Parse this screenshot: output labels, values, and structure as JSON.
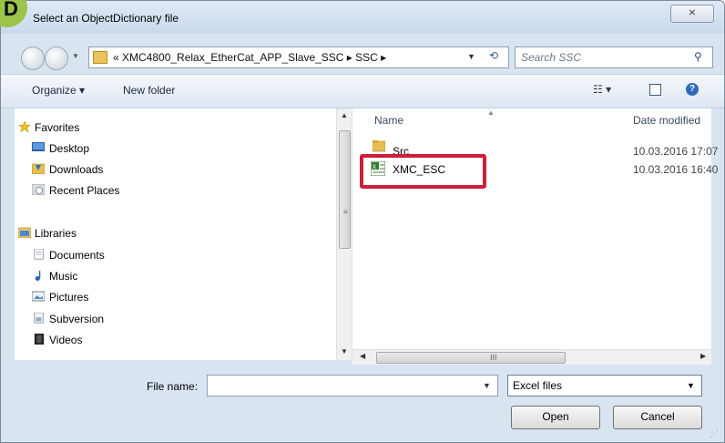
{
  "window": {
    "title": "Select an ObjectDictionary file",
    "close_glyph": "⨯"
  },
  "badge": {
    "letter": "D",
    "color": "#9cc34a"
  },
  "address": {
    "text": "« XMC4800_Relax_EtherCat_APP_Slave_SSC  ▸  SSC  ▸",
    "search_placeholder": "Search SSC"
  },
  "toolbar": {
    "organize": "Organize ▾",
    "new_folder": "New folder",
    "view_glyph": "☷ ▾",
    "help_glyph": "?"
  },
  "nav": {
    "items": [
      {
        "label": "Favorites",
        "icon": "star-icon"
      },
      {
        "label": "Desktop",
        "icon": "desktop-icon"
      },
      {
        "label": "Downloads",
        "icon": "downloads-icon"
      },
      {
        "label": "Recent Places",
        "icon": "recent-places-icon"
      },
      {
        "label": "Libraries",
        "icon": "libraries-icon"
      },
      {
        "label": "Documents",
        "icon": "document-icon"
      },
      {
        "label": "Music",
        "icon": "music-icon"
      },
      {
        "label": "Pictures",
        "icon": "pictures-icon"
      },
      {
        "label": "Subversion",
        "icon": "subversion-icon"
      },
      {
        "label": "Videos",
        "icon": "videos-icon"
      }
    ]
  },
  "files": {
    "columns": {
      "name": "Name",
      "date": "Date modified"
    },
    "rows": [
      {
        "name": "Src",
        "date": "10.03.2016 17:07",
        "icon": "folder-icon"
      },
      {
        "name": "XMC_ESC",
        "date": "10.03.2016 16:40",
        "icon": "excel-file-icon"
      }
    ]
  },
  "scroll": {
    "h_grip": "III"
  },
  "bottom": {
    "file_name_label": "File name:",
    "file_name_value": "",
    "file_type": "Excel files",
    "open": "Open",
    "cancel": "Cancel"
  },
  "colors": {
    "highlight": "#cc1f3c",
    "window_bg": "#d9e4f1"
  }
}
